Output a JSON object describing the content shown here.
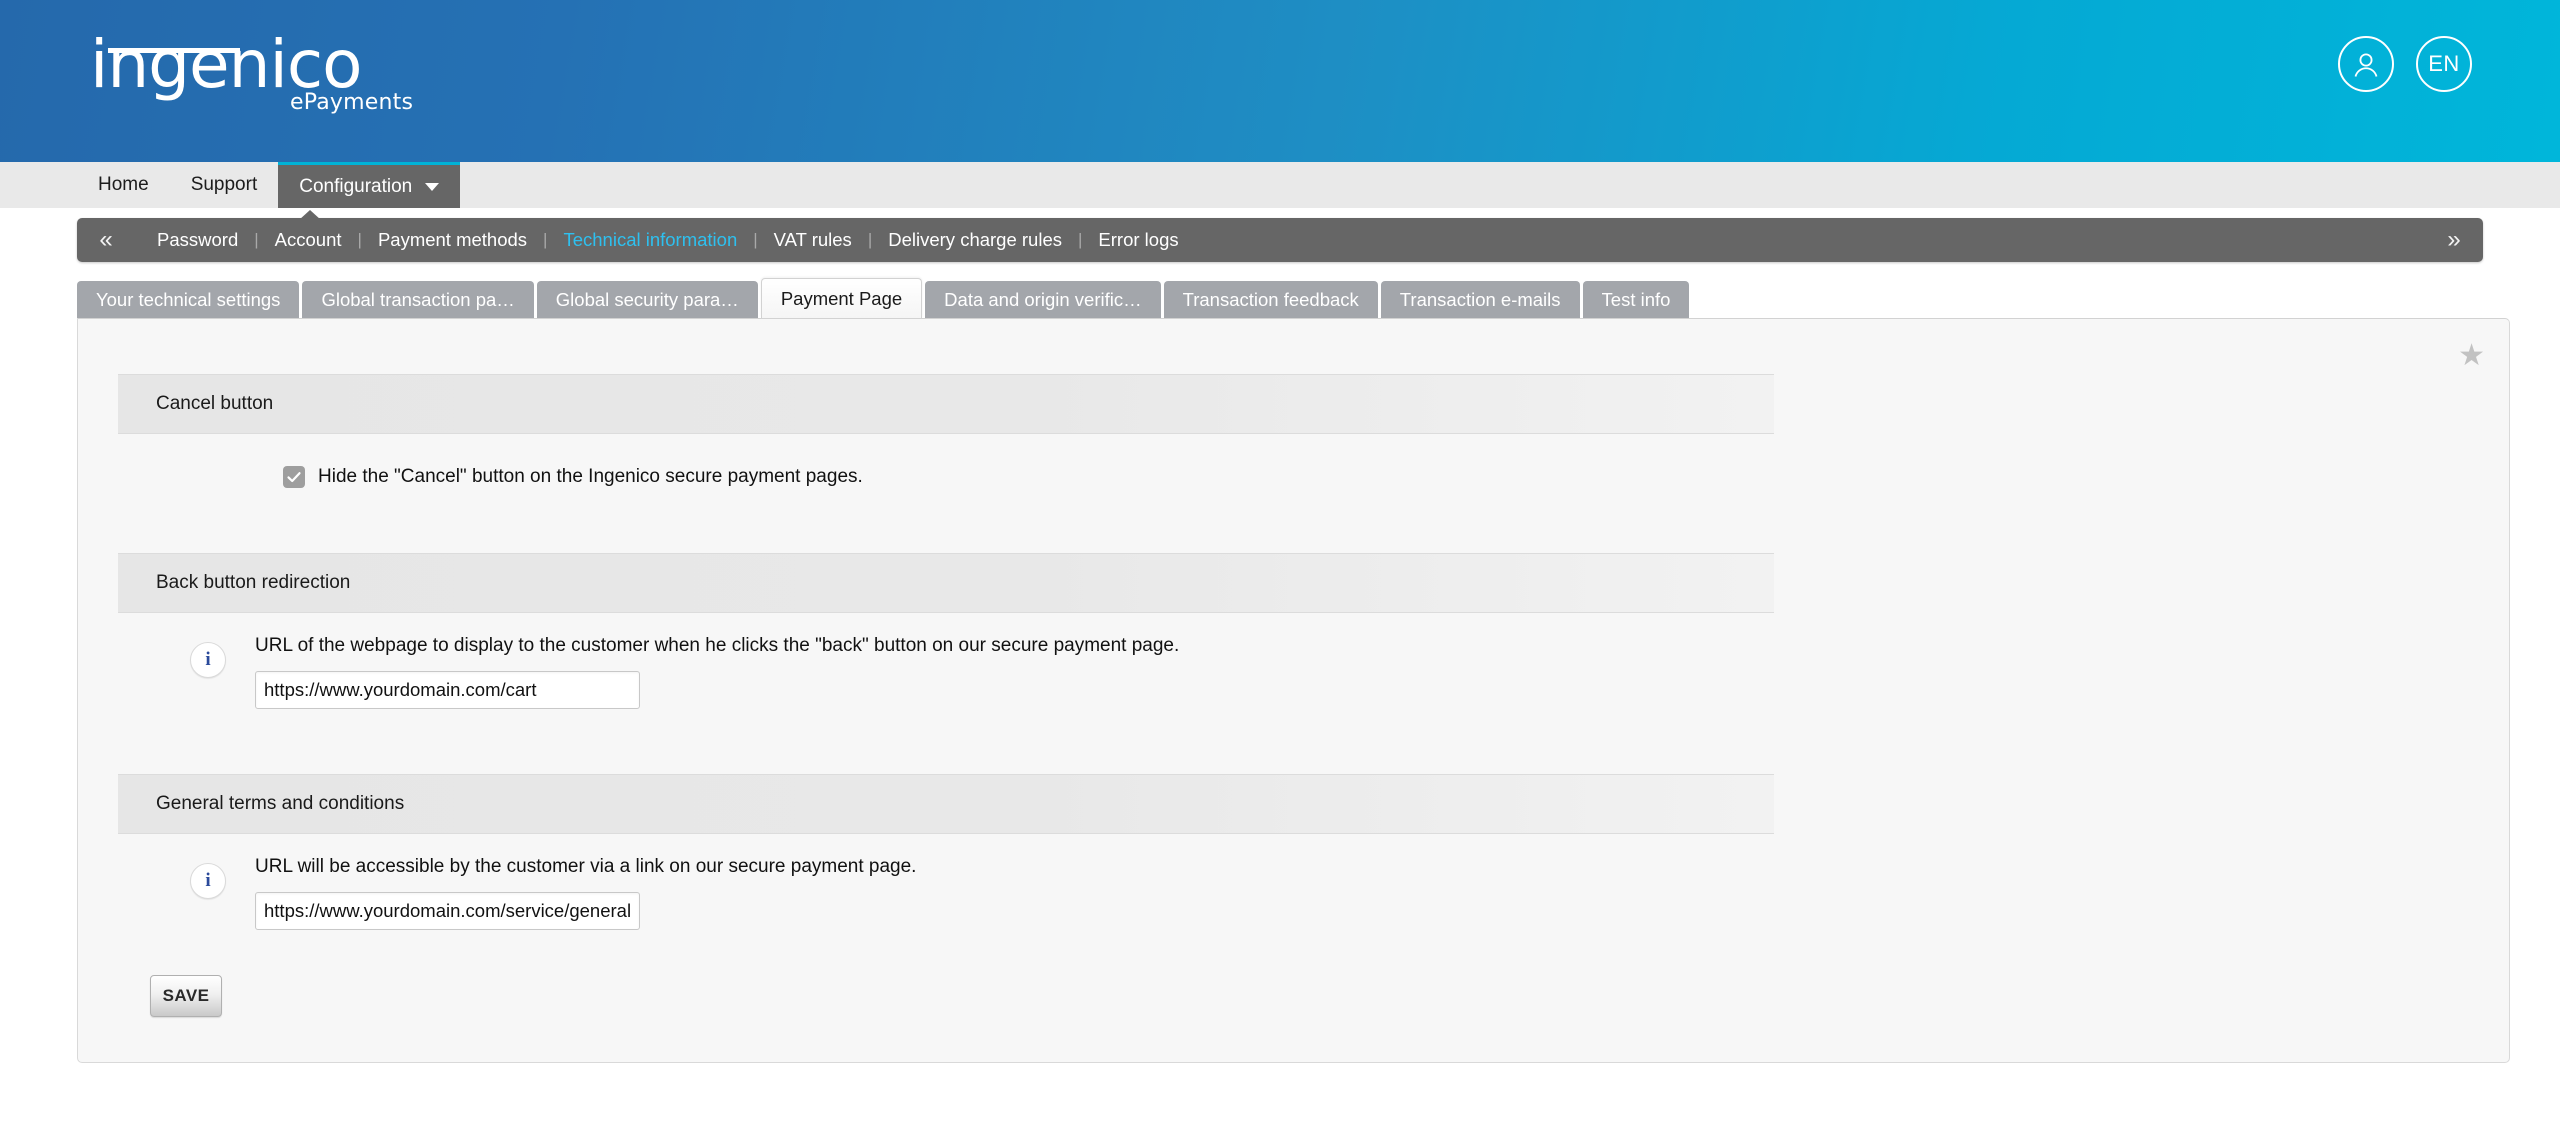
{
  "header": {
    "logo_word": "ingenico",
    "logo_sub": "ePayments",
    "account_icon": "user-account-icon",
    "language_label": "EN",
    "gradient_start": "#2569ac",
    "gradient_end": "#00b6da"
  },
  "mainnav": {
    "items": [
      {
        "label": "Home",
        "active": false
      },
      {
        "label": "Support",
        "active": false
      },
      {
        "label": "Configuration",
        "active": true,
        "has_caret": true
      }
    ]
  },
  "subnav": {
    "prev_arrow": "«",
    "next_arrow": "»",
    "separator": "|",
    "accent_color": "#2ec0ef",
    "items": [
      {
        "label": "Password",
        "active": false
      },
      {
        "label": "Account",
        "active": false
      },
      {
        "label": "Payment methods",
        "active": false
      },
      {
        "label": "Technical information",
        "active": true
      },
      {
        "label": "VAT rules",
        "active": false
      },
      {
        "label": "Delivery charge rules",
        "active": false
      },
      {
        "label": "Error logs",
        "active": false
      }
    ]
  },
  "tabs": [
    {
      "label": "Your technical settings",
      "active": false
    },
    {
      "label": "Global transaction pa…",
      "active": false
    },
    {
      "label": "Global security para…",
      "active": false
    },
    {
      "label": "Payment Page",
      "active": true
    },
    {
      "label": "Data and origin verific…",
      "active": false
    },
    {
      "label": "Transaction feedback",
      "active": false
    },
    {
      "label": "Transaction e-mails",
      "active": false
    },
    {
      "label": "Test info",
      "active": false
    }
  ],
  "panel": {
    "favorite_icon": "star-icon",
    "sections": {
      "cancel_button": {
        "title": "Cancel button",
        "checkbox_checked": true,
        "checkbox_label": "Hide the \"Cancel\" button on the Ingenico secure payment pages."
      },
      "back_button": {
        "title": "Back button redirection",
        "info_icon": "info-icon",
        "description": "URL of the webpage to display to the customer when he clicks the \"back\" button on our secure payment page.",
        "input_value": "https://www.yourdomain.com/cart",
        "input_placeholder": ""
      },
      "terms": {
        "title": "General terms and conditions",
        "info_icon": "info-icon",
        "description": "URL will be accessible by the customer via a link on our secure payment page.",
        "input_value": "https://www.yourdomain.com/service/general-terms-conditions",
        "input_placeholder": ""
      }
    },
    "save_label": "SAVE"
  }
}
